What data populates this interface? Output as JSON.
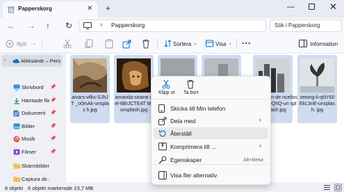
{
  "window": {
    "tab_title": "Papperskorg",
    "tab_close": "✕",
    "new_tab": "+",
    "minimize": "—",
    "close": "✕"
  },
  "address": {
    "back": "←",
    "forward": "→",
    "up": "↑",
    "refresh": "↻",
    "separator": "›",
    "path": "Papperskorg",
    "search_placeholder": "Sök i Papperskorg"
  },
  "toolbar": {
    "new_label": "Nytt",
    "sort_label": "Sortera",
    "view_label": "Visa",
    "more": "···",
    "info_label": "Information",
    "chevron": "⌄"
  },
  "sidebar": {
    "onedrive_label": "Aleksandr – Pers",
    "items": [
      {
        "label": "Skrivbord",
        "pinned": true
      },
      {
        "label": "Hämtade filer",
        "pinned": true
      },
      {
        "label": "Dokument",
        "pinned": true
      },
      {
        "label": "Bilder",
        "pinned": true
      },
      {
        "label": "Musik",
        "pinned": true
      },
      {
        "label": "Filmer",
        "pinned": true
      },
      {
        "label": "Skärmbilder",
        "pinned": false
      },
      {
        "label": "Captura de ecrã",
        "pinned": false
      }
    ],
    "pin": "📌"
  },
  "files": [
    {
      "name": "aivars-vilks-SJhJT_o0mAk-unsplash.jpg",
      "caption": "aivars-vilks-SJhJT _o0mAk-unsplas h.jpg"
    },
    {
      "name": "amanda-swanepoel-6BrJCTEATM-unsplash.jpg",
      "caption": "amanda-swane oel-6BrJCTEAT M-unsplash.jpg"
    },
    {
      "name": "",
      "caption": ""
    },
    {
      "name": "",
      "caption": ""
    },
    {
      "name": "...-justen-de ...ncellos-fC ...DQhQ-un splash.jpg",
      "caption": "-justen-de ncellos-fC DQhQ-un splash.jpg"
    },
    {
      "name": "zetong-li-qNY60EkL3nE-unsplash.jpg",
      "caption": "zetong-li-qNY60 EkL3nE-unsplash. jpg"
    }
  ],
  "status": {
    "count": "6 objekt",
    "selected": "6 objekt markerade  23,7 MB"
  },
  "context_menu": {
    "top_actions": [
      {
        "label": "Klipp ut",
        "icon": "scissors-icon"
      },
      {
        "label": "Ta bort",
        "icon": "trash-icon"
      }
    ],
    "items": [
      {
        "label": "Skicka till Min telefon",
        "icon": "phone-icon",
        "submenu": false
      },
      {
        "label": "Dela med",
        "icon": "share-icon",
        "submenu": true
      },
      {
        "label": "Återställ",
        "icon": "restore-icon",
        "submenu": false,
        "highlighted": true
      },
      {
        "label": "Komprimera till ...",
        "icon": "archive-icon",
        "submenu": true
      },
      {
        "label": "Egenskaper",
        "icon": "properties-icon",
        "submenu": false,
        "shortcut": "Alt+Retur"
      },
      {
        "label": "Visa fler alternativ",
        "icon": "more-options-icon",
        "submenu": false
      }
    ],
    "arrow": "›"
  },
  "colors": {
    "accent": "#0067c0",
    "selection": "#cfdbf0",
    "window_bg": "#eef0f6"
  }
}
